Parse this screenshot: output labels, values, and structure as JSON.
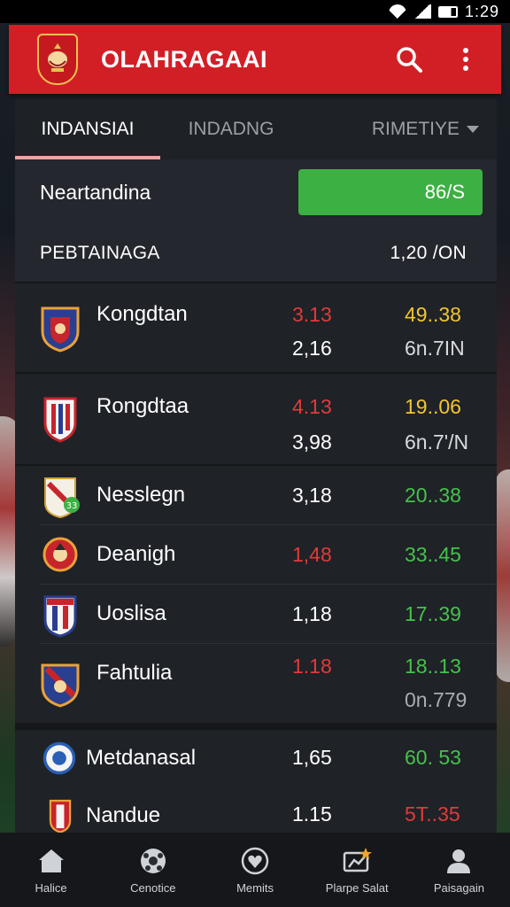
{
  "status": {
    "time": "1:29"
  },
  "app_bar": {
    "title": "OLAHRAGAAI"
  },
  "tabs": [
    {
      "label": "INDANSIAI"
    },
    {
      "label": "INDADNG"
    },
    {
      "label": "RIMETIYE"
    }
  ],
  "summary": {
    "label": "Neartandina",
    "badge": "86/S"
  },
  "table_header": {
    "left": "PEBTAINAGA",
    "right": "1,20 /ON"
  },
  "rows": [
    {
      "team": "Kongdtan",
      "v1": "3.13",
      "v2": "49..38",
      "s1": "2,16",
      "s2": "6n.7IN"
    },
    {
      "team": "Rongdtaa",
      "v1": "4.13",
      "v2": "19..06",
      "s1": "3,98",
      "s2": "6n.7'/N"
    },
    {
      "team": "Nesslegn",
      "v1": "3,18",
      "v2": "20..38"
    },
    {
      "team": "Deanigh",
      "v1": "1,48",
      "v2": "33..45"
    },
    {
      "team": "Uoslisa",
      "v1": "1,18",
      "v2": "17..39"
    },
    {
      "team": "Fahtulia",
      "v1": "1.18",
      "v2": "18..13",
      "s2": "0n.779"
    },
    {
      "team": "Metdanasal",
      "v1": "1,65",
      "v2": "60. 53"
    },
    {
      "team": "Nandue",
      "v1": "1.15",
      "v2": "5T..35"
    }
  ],
  "bottom_nav": [
    {
      "label": "Halice",
      "icon": "home-icon"
    },
    {
      "label": "Cenotice",
      "icon": "ball-icon"
    },
    {
      "label": "Memits",
      "icon": "heart-icon"
    },
    {
      "label": "Plarpe Salat",
      "icon": "trophy-icon"
    },
    {
      "label": "Paisagain",
      "icon": "profile-icon"
    }
  ],
  "colors": {
    "app_bar": "#d21f26",
    "badge": "#3db043",
    "red_value": "#e13a3a",
    "yellow_value": "#f2c531",
    "green_value": "#45c24b",
    "tab_underline": "#e8a7a0"
  }
}
